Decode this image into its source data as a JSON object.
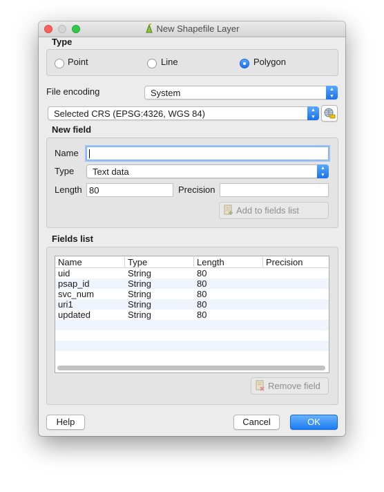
{
  "window": {
    "title": "New Shapefile Layer"
  },
  "type_group": {
    "title": "Type",
    "options": [
      {
        "label": "Point",
        "checked": false
      },
      {
        "label": "Line",
        "checked": false
      },
      {
        "label": "Polygon",
        "checked": true
      }
    ]
  },
  "file_encoding": {
    "label": "File encoding",
    "value": "System"
  },
  "crs": {
    "value": "Selected CRS (EPSG:4326, WGS 84)"
  },
  "new_field": {
    "title": "New field",
    "name_label": "Name",
    "name_value": "",
    "type_label": "Type",
    "type_value": "Text data",
    "length_label": "Length",
    "length_value": "80",
    "precision_label": "Precision",
    "precision_value": "",
    "add_button": "Add to fields list"
  },
  "fields_list": {
    "title": "Fields list",
    "columns": [
      "Name",
      "Type",
      "Length",
      "Precision"
    ],
    "rows": [
      [
        "uid",
        "String",
        "80",
        ""
      ],
      [
        "psap_id",
        "String",
        "80",
        ""
      ],
      [
        "svc_num",
        "String",
        "80",
        ""
      ],
      [
        "uri1",
        "String",
        "80",
        ""
      ],
      [
        "updated",
        "String",
        "80",
        ""
      ]
    ],
    "remove_button": "Remove field"
  },
  "buttons": {
    "help": "Help",
    "cancel": "Cancel",
    "ok": "OK"
  }
}
